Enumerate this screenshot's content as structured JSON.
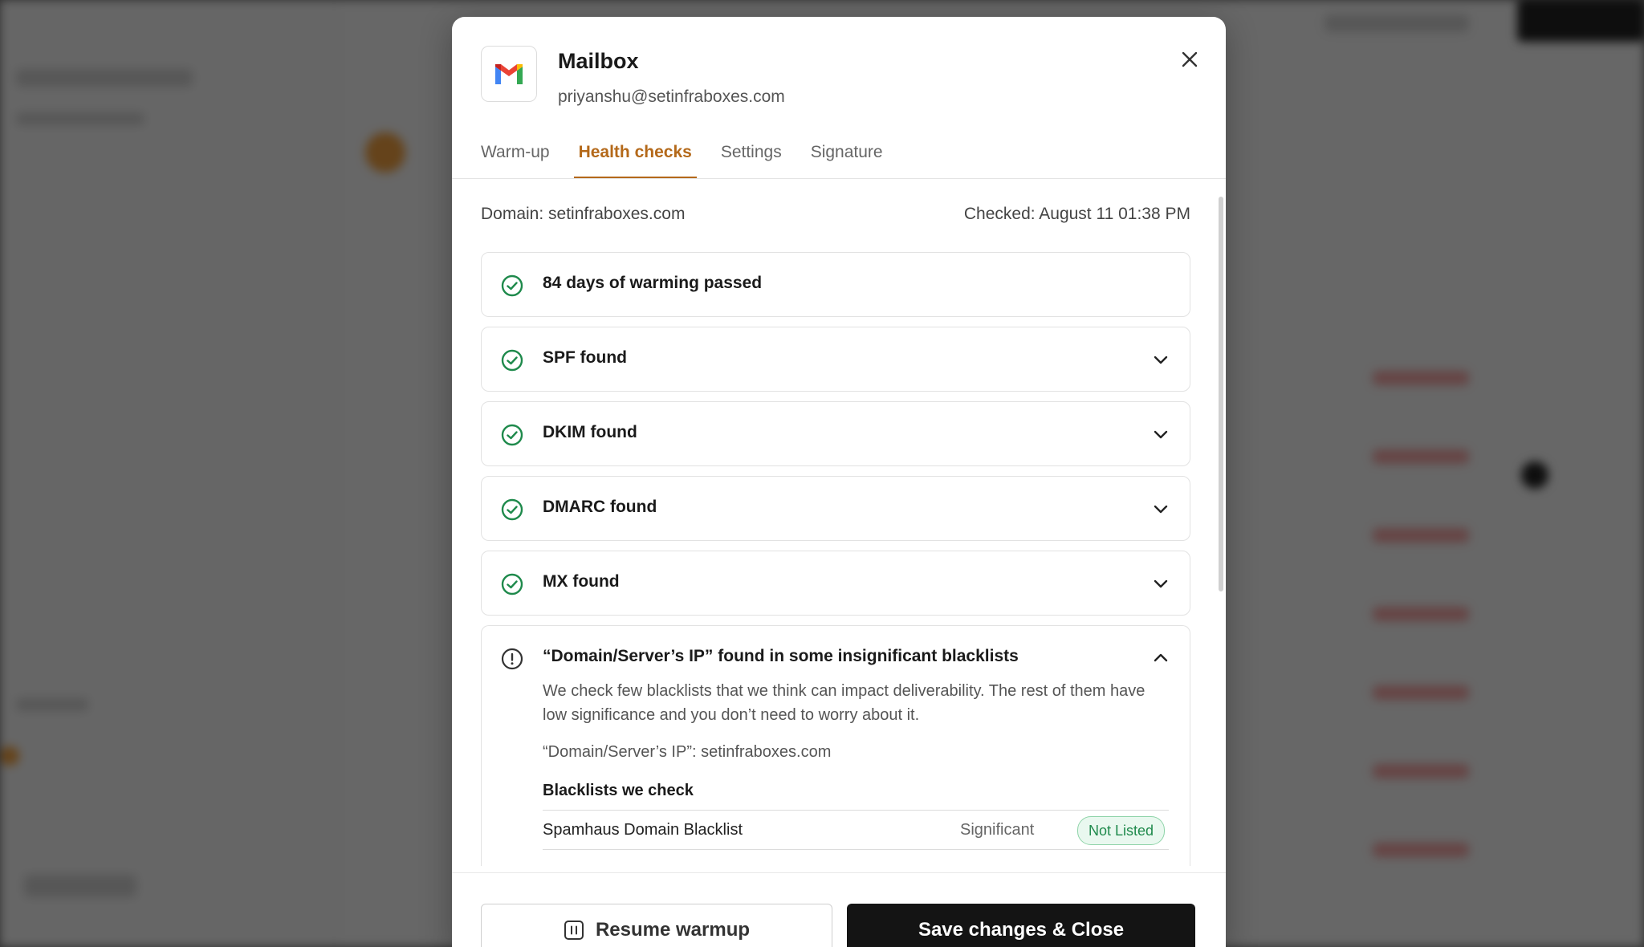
{
  "mailbox": {
    "title": "Mailbox",
    "email": "priyanshu@setinfraboxes.com",
    "logo_icon": "gmail-logo-icon"
  },
  "tabs": [
    {
      "label": "Warm-up",
      "active": false
    },
    {
      "label": "Health checks",
      "active": true
    },
    {
      "label": "Settings",
      "active": false
    },
    {
      "label": "Signature",
      "active": false
    }
  ],
  "health": {
    "domain": "Domain: setinfraboxes.com",
    "checked": "Checked: August 11 01:38 PM",
    "checks": [
      {
        "label": "84 days of warming passed",
        "status": "pass",
        "expandable": false
      },
      {
        "label": "SPF found",
        "status": "pass",
        "expandable": true
      },
      {
        "label": "DKIM found",
        "status": "pass",
        "expandable": true
      },
      {
        "label": "DMARC found",
        "status": "pass",
        "expandable": true
      },
      {
        "label": "MX found",
        "status": "pass",
        "expandable": true
      }
    ],
    "blacklist": {
      "label": "“Domain/Server’s IP” found in some insignificant blacklists",
      "status": "warning",
      "description": "We check few blacklists that we think can impact deliverability. The rest of them have low significance and you don’t need to worry about it.",
      "ip_line": "“Domain/Server’s IP”: setinfraboxes.com",
      "lists_heading": "Blacklists we check",
      "rows": [
        {
          "name": "Spamhaus Domain Blacklist",
          "significance": "Significant",
          "status": "Not Listed"
        }
      ]
    }
  },
  "footer": {
    "resume_label": "Resume warmup",
    "save_label": "Save changes & Close"
  },
  "colors": {
    "accent": "#b4691a",
    "success": "#1f8a4c",
    "primary_button": "#141414"
  }
}
